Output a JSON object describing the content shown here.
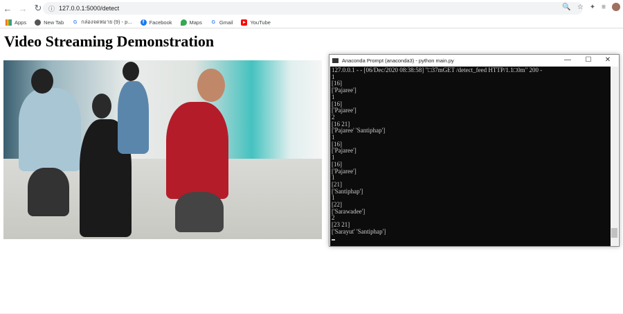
{
  "browser": {
    "url": "127.0.0.1:5000/detect",
    "bookmarks": [
      {
        "label": "Apps",
        "icon": "apps-grid-icon"
      },
      {
        "label": "New Tab",
        "icon": "globe-icon"
      },
      {
        "label": "กล่องจดหมาย (9) - p...",
        "icon": "google-icon"
      },
      {
        "label": "Facebook",
        "icon": "facebook-icon"
      },
      {
        "label": "Maps",
        "icon": "maps-pin-icon"
      },
      {
        "label": "Gmail",
        "icon": "google-icon"
      },
      {
        "label": "YouTube",
        "icon": "youtube-icon"
      }
    ]
  },
  "page": {
    "title": "Video Streaming Demonstration"
  },
  "terminal": {
    "title": "Anaconda Prompt (anaconda3) - python  main.py",
    "lines": [
      "127.0.0.1 - - [06/Dec/2020 08:38:58] \"□37mGET /detect_feed HTTP/1.1□0m\" 200 -",
      "1",
      "[16]",
      "['Pajaree']",
      "1",
      "[16]",
      "['Pajaree']",
      "2",
      "[16 21]",
      "['Pajaree' 'Santiphap']",
      "1",
      "[16]",
      "['Pajaree']",
      "1",
      "[16]",
      "['Pajaree']",
      "1",
      "[21]",
      "['Santiphap']",
      "1",
      "[22]",
      "['Sarawadee']",
      "2",
      "[23 21]",
      "['Sarayut' 'Santiphap']"
    ]
  }
}
